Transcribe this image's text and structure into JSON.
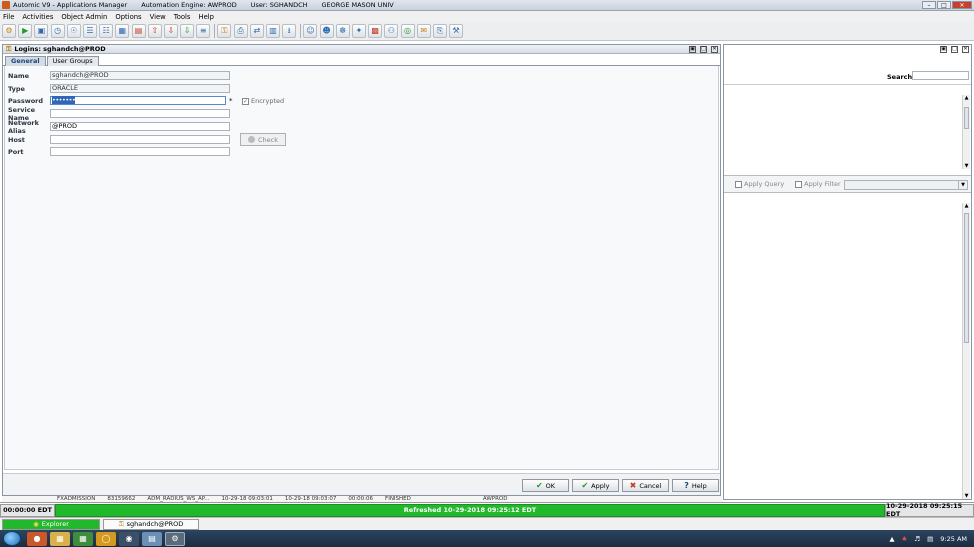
{
  "window": {
    "app_title": "Automic V9 - Applications Manager",
    "engine": "Automation Engine: AWPROD",
    "user": "User: SGHANDCH",
    "org": "GEORGE MASON UNIV",
    "controls": [
      "–",
      "□",
      "✕"
    ]
  },
  "menu": [
    "File",
    "Activities",
    "Object Admin",
    "Options",
    "View",
    "Tools",
    "Help"
  ],
  "toolbar": [
    {
      "icon": "new-object-icon",
      "glyph": "⚙",
      "tone": "o"
    },
    {
      "icon": "run-icon",
      "glyph": "▶",
      "tone": "g"
    },
    {
      "icon": "monitor-icon",
      "glyph": "▣",
      "tone": ""
    },
    {
      "icon": "schedule-icon",
      "glyph": "◷",
      "tone": ""
    },
    {
      "icon": "queue-icon",
      "glyph": "☉",
      "tone": ""
    },
    {
      "icon": "document-icon",
      "glyph": "☰",
      "tone": ""
    },
    {
      "icon": "book-icon",
      "glyph": "☷",
      "tone": ""
    },
    {
      "icon": "calendar-icon",
      "glyph": "▦",
      "tone": ""
    },
    {
      "icon": "report-icon",
      "glyph": "▤",
      "tone": "r"
    },
    {
      "icon": "upload-icon",
      "glyph": "⇧",
      "tone": "r"
    },
    {
      "icon": "download-icon",
      "glyph": "⇩",
      "tone": "r"
    },
    {
      "icon": "import-icon",
      "glyph": "⇩",
      "tone": "g"
    },
    {
      "icon": "list-icon",
      "glyph": "≡",
      "tone": ""
    },
    {
      "icon": "key-icon",
      "glyph": "⚿",
      "tone": "o"
    },
    {
      "icon": "printer-icon",
      "glyph": "⎙",
      "tone": ""
    },
    {
      "icon": "transfer-icon",
      "glyph": "⇄",
      "tone": ""
    },
    {
      "icon": "server-icon",
      "glyph": "▥",
      "tone": ""
    },
    {
      "icon": "output-icon",
      "glyph": "⭳",
      "tone": ""
    },
    {
      "icon": "users-icon",
      "glyph": "☺",
      "tone": ""
    },
    {
      "icon": "user-group-icon",
      "glyph": "☻",
      "tone": ""
    },
    {
      "icon": "settings-icon",
      "glyph": "☸",
      "tone": ""
    },
    {
      "icon": "network-icon",
      "glyph": "✦",
      "tone": ""
    },
    {
      "icon": "task-icon",
      "glyph": "▩",
      "tone": "r"
    },
    {
      "icon": "person-icon",
      "glyph": "⚇",
      "tone": ""
    },
    {
      "icon": "globe-icon",
      "glyph": "◎",
      "tone": "g"
    },
    {
      "icon": "mail-icon",
      "glyph": "✉",
      "tone": "o"
    },
    {
      "icon": "clipboard-icon",
      "glyph": "⎘",
      "tone": ""
    },
    {
      "icon": "tools-icon",
      "glyph": "⚒",
      "tone": ""
    }
  ],
  "login_window": {
    "title": "Logins: sghandch@PROD",
    "tabs": [
      "General",
      "User Groups"
    ],
    "fields": {
      "name": {
        "label": "Name",
        "value": "sghandch@PROD"
      },
      "type": {
        "label": "Type",
        "value": "ORACLE"
      },
      "password": {
        "label": "Password",
        "value": "•••••••"
      },
      "service_name": {
        "label": "Service Name",
        "value": ""
      },
      "network_alias": {
        "label": "Network Alias",
        "value": "@PROD"
      },
      "host": {
        "label": "Host",
        "value": ""
      },
      "port": {
        "label": "Port",
        "value": ""
      }
    },
    "required_mark": "*",
    "encrypted_label": "Encrypted",
    "check_label": "Check",
    "buttons": {
      "ok": "OK",
      "apply": "Apply",
      "cancel": "Cancel",
      "help": "Help"
    }
  },
  "right_panel": {
    "search_label": "Search",
    "apply_query": "Apply Query",
    "apply_filter": "Apply Filter"
  },
  "hidden_row": [
    "FXADMISSION",
    "83159662",
    "ADM_RADIUS_WS_AP...",
    "10-29-18 09:03:01",
    "10-29-18 09:03:07",
    "00:00:06",
    "FINISHED",
    "AWPROD"
  ],
  "status": {
    "left": "00:00:00 EDT",
    "center": "Refreshed 10-29-2018 09:25:12 EDT",
    "right": "10-29-2018 09:25:15 EDT"
  },
  "tasks": {
    "explorer": "Explorer",
    "login": "sghandch@PROD"
  },
  "tray": {
    "time": "9:25 AM"
  }
}
